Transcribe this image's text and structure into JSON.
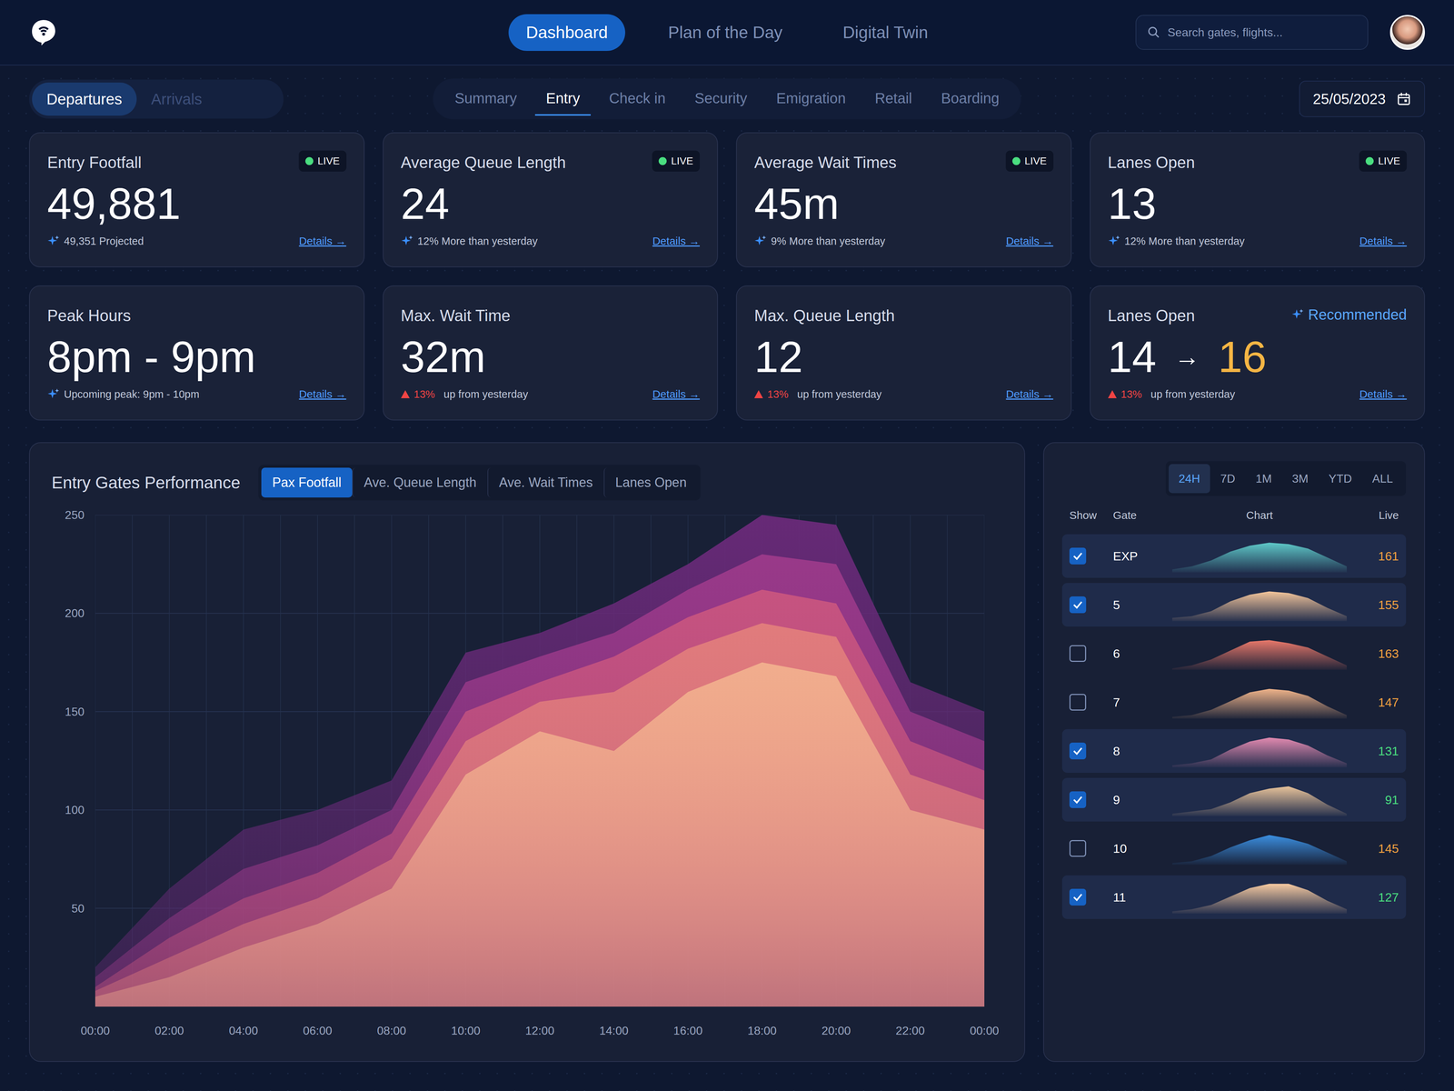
{
  "nav": [
    {
      "label": "Dashboard",
      "selected": true
    },
    {
      "label": "Plan of the Day",
      "selected": false
    },
    {
      "label": "Digital Twin",
      "selected": false
    }
  ],
  "search": {
    "placeholder": "Search gates, flights..."
  },
  "date": "25/05/2023",
  "direction": [
    {
      "label": "Departures",
      "selected": true
    },
    {
      "label": "Arrivals",
      "selected": false
    }
  ],
  "subtabs": [
    {
      "label": "Summary",
      "selected": false
    },
    {
      "label": "Entry",
      "selected": true
    },
    {
      "label": "Check in",
      "selected": false
    },
    {
      "label": "Security",
      "selected": false
    },
    {
      "label": "Emigration",
      "selected": false
    },
    {
      "label": "Retail",
      "selected": false
    },
    {
      "label": "Boarding",
      "selected": false
    }
  ],
  "cards": [
    {
      "kind": "sparkle",
      "title": "Entry Footfall",
      "value": "49,881",
      "live": true,
      "live_label": "LIVE",
      "note": "49,351 Projected",
      "details": "Details →"
    },
    {
      "kind": "sparkle",
      "title": "Average Queue Length",
      "value": "24",
      "live": true,
      "live_label": "LIVE",
      "note": "12% More than yesterday",
      "details": "Details →"
    },
    {
      "kind": "sparkle",
      "title": "Average Wait Times",
      "value": "45m",
      "live": true,
      "live_label": "LIVE",
      "note": "9% More than yesterday",
      "details": "Details →"
    },
    {
      "kind": "sparkle",
      "title": "Lanes Open",
      "value": "13",
      "live": true,
      "live_label": "LIVE",
      "note": "12% More than yesterday",
      "details": "Details →"
    },
    {
      "kind": "sparkle",
      "title": "Peak Hours",
      "value": "8pm - 9pm",
      "live": false,
      "note": "Upcoming peak: 9pm - 10pm",
      "details": "Details →"
    },
    {
      "kind": "change",
      "title": "Max. Wait Time",
      "value": "32m",
      "live": false,
      "change": "13%",
      "note": "up from yesterday",
      "details": "Details →"
    },
    {
      "kind": "change",
      "title": "Max. Queue Length",
      "value": "12",
      "live": false,
      "change": "13%",
      "note": "up from yesterday",
      "details": "Details →"
    },
    {
      "kind": "recommend",
      "title": "Lanes Open",
      "value": "14",
      "arrow": "→",
      "recommended_label": "Recommended",
      "recommended_value": "16",
      "live": false,
      "change": "13%",
      "note": "up from yesterday",
      "details": "Details →"
    }
  ],
  "chart": {
    "title": "Entry Gates Performance",
    "metrics": [
      {
        "label": "Pax Footfall",
        "selected": true
      },
      {
        "label": "Ave. Queue Length",
        "selected": false
      },
      {
        "label": "Ave. Wait Times",
        "selected": false
      },
      {
        "label": "Lanes Open",
        "selected": false
      }
    ],
    "y_ticks": [
      "250",
      "200",
      "150",
      "100",
      "50"
    ],
    "x_ticks": [
      "00:00",
      "02:00",
      "04:00",
      "06:00",
      "08:00",
      "10:00",
      "12:00",
      "14:00",
      "16:00",
      "18:00",
      "20:00",
      "22:00",
      "00:00"
    ],
    "series": [
      {
        "color": "#6b2a7a",
        "values": [
          20,
          60,
          90,
          100,
          115,
          180,
          190,
          205,
          225,
          250,
          245,
          165,
          150
        ]
      },
      {
        "color": "#9c3a8a",
        "values": [
          15,
          45,
          70,
          82,
          100,
          165,
          178,
          190,
          212,
          230,
          225,
          150,
          135
        ]
      },
      {
        "color": "#c9557f",
        "values": [
          10,
          35,
          55,
          68,
          88,
          150,
          165,
          178,
          198,
          212,
          205,
          135,
          120
        ]
      },
      {
        "color": "#e27e7c",
        "values": [
          8,
          25,
          42,
          55,
          75,
          135,
          155,
          160,
          182,
          195,
          188,
          118,
          105
        ]
      },
      {
        "color": "#f2b08e",
        "values": [
          5,
          15,
          30,
          42,
          60,
          118,
          140,
          130,
          160,
          175,
          168,
          100,
          90
        ]
      }
    ]
  },
  "ranges": [
    {
      "label": "24H",
      "selected": true
    },
    {
      "label": "7D",
      "selected": false
    },
    {
      "label": "1M",
      "selected": false
    },
    {
      "label": "3M",
      "selected": false
    },
    {
      "label": "YTD",
      "selected": false
    },
    {
      "label": "ALL",
      "selected": false
    }
  ],
  "gate_table": {
    "columns": [
      "Show",
      "Gate",
      "Chart",
      "Live"
    ],
    "rows": [
      {
        "gate": "EXP",
        "checked": true,
        "live": "161",
        "live_color": "#f0a040",
        "color": "#5ec8c8",
        "spark": [
          2,
          4,
          8,
          14,
          18,
          20,
          19,
          16,
          10,
          4
        ]
      },
      {
        "gate": "5",
        "checked": true,
        "live": "155",
        "live_color": "#f0a040",
        "color": "#f2c49a",
        "spark": [
          2,
          3,
          6,
          12,
          16,
          18,
          17,
          14,
          8,
          3
        ]
      },
      {
        "gate": "6",
        "checked": false,
        "live": "163",
        "live_color": "#f0a040",
        "color": "#e8786a",
        "spark": [
          1,
          3,
          7,
          13,
          19,
          20,
          18,
          15,
          9,
          3
        ]
      },
      {
        "gate": "7",
        "checked": false,
        "live": "147",
        "live_color": "#f0a040",
        "color": "#f0b48a",
        "spark": [
          1,
          2,
          5,
          10,
          15,
          17,
          16,
          13,
          7,
          2
        ]
      },
      {
        "gate": "8",
        "checked": true,
        "live": "131",
        "live_color": "#4ade80",
        "color": "#e28ab0",
        "spark": [
          1,
          2,
          4,
          9,
          13,
          15,
          14,
          11,
          6,
          2
        ]
      },
      {
        "gate": "9",
        "checked": true,
        "live": "91",
        "live_color": "#4ade80",
        "color": "#e8c39a",
        "spark": [
          1,
          2,
          3,
          6,
          10,
          12,
          13,
          10,
          5,
          1
        ]
      },
      {
        "gate": "10",
        "checked": false,
        "live": "145",
        "live_color": "#f0a040",
        "color": "#3b8fe0",
        "spark": [
          1,
          2,
          5,
          10,
          14,
          17,
          15,
          12,
          7,
          2
        ]
      },
      {
        "gate": "11",
        "checked": true,
        "live": "127",
        "live_color": "#4ade80",
        "color": "#f5c9a0",
        "spark": [
          1,
          2,
          4,
          8,
          12,
          14,
          14,
          11,
          6,
          2
        ]
      }
    ]
  }
}
